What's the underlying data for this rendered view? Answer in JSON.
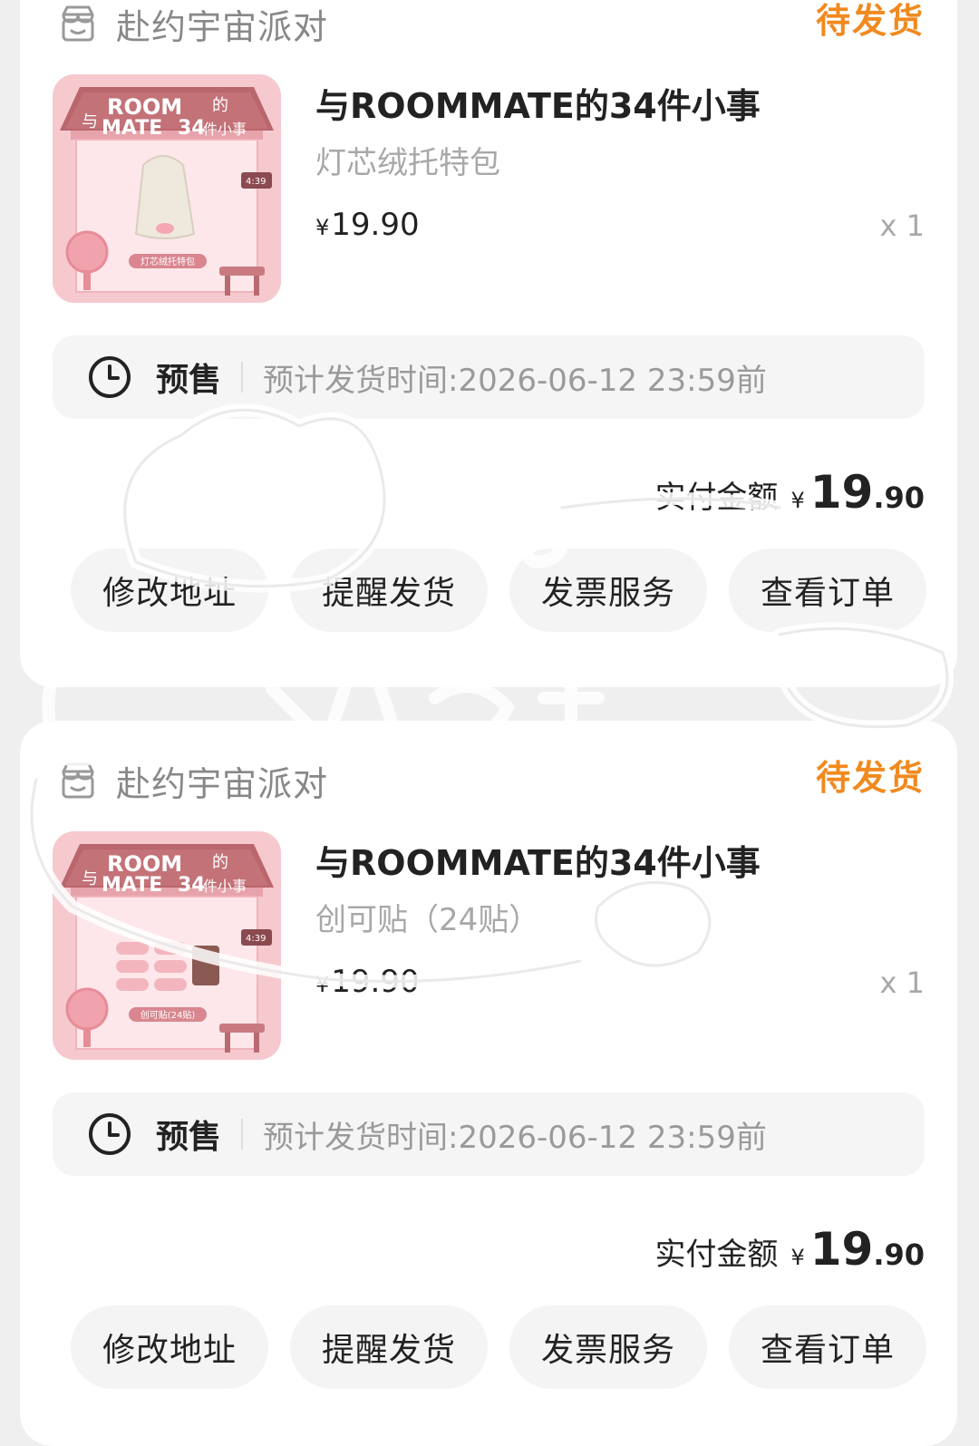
{
  "orders": [
    {
      "shop": "赴约宇宙派对",
      "status": "待发货",
      "product": {
        "title": "与ROOMMATE的34件小事",
        "variant": "灯芯绒托特包",
        "price": "19.90",
        "currency": "¥",
        "qty": "x 1",
        "thumb_caption": "灯芯绒托特包",
        "thumb_time": "4:39"
      },
      "presale": {
        "label": "预售",
        "text": "预计发货时间:2026-06-12 23:59前"
      },
      "paid": {
        "label": "实付金额",
        "currency": "¥",
        "int": "19",
        "dec": ".90"
      },
      "buttons": [
        "修改地址",
        "提醒发货",
        "发票服务",
        "查看订单"
      ]
    },
    {
      "shop": "赴约宇宙派对",
      "status": "待发货",
      "product": {
        "title": "与ROOMMATE的34件小事",
        "variant": "创可贴（24贴）",
        "price": "19.90",
        "currency": "¥",
        "qty": "x 1",
        "thumb_caption": "创可贴(24贴)",
        "thumb_time": "4:39"
      },
      "presale": {
        "label": "预售",
        "text": "预计发货时间:2026-06-12 23:59前"
      },
      "paid": {
        "label": "实付金额",
        "currency": "¥",
        "int": "19",
        "dec": ".90"
      },
      "buttons": [
        "修改地址",
        "提醒发货",
        "发票服务",
        "查看订单"
      ]
    }
  ],
  "thumb_art_text": {
    "line1": "ROOM",
    "line2": "MATE",
    "with": "与",
    "de": "的",
    "num": "34",
    "jian": "件小事"
  },
  "colors": {
    "status": "#f08a1f",
    "thumb_bg": "#f6c9cf",
    "roof": "#b9666c"
  }
}
